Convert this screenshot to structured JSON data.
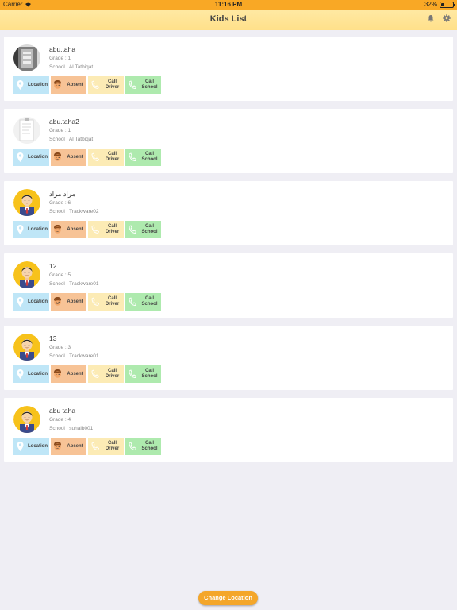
{
  "status_bar": {
    "carrier": "Carrier",
    "time": "11:16 PM",
    "battery": "32%",
    "battery_level": 0.32
  },
  "nav": {
    "title": "Kids List",
    "icons": [
      "bell-icon",
      "gear-icon"
    ]
  },
  "actions": {
    "location": "Location",
    "absent": "Absent",
    "call_driver": [
      "Call",
      "Driver"
    ],
    "call_school": [
      "Call",
      "School"
    ]
  },
  "kids": [
    {
      "name": "abu.taha",
      "grade": "Grade : 1",
      "school": "School : Al Tatbiqat",
      "avatar": "photo-dark"
    },
    {
      "name": "abu.taha2",
      "grade": "Grade : 1",
      "school": "School : Al Tatbiqat",
      "avatar": "photo-light"
    },
    {
      "name": "مراد مراد",
      "grade": "Grade : 6",
      "school": "School : Trackware02",
      "avatar": "cartoon-boy"
    },
    {
      "name": "12",
      "grade": "Grade : 5",
      "school": "School : Trackware01",
      "avatar": "cartoon-boy"
    },
    {
      "name": "13",
      "grade": "Grade : 3",
      "school": "School : Trackware01",
      "avatar": "cartoon-boy"
    },
    {
      "name": "abu taha",
      "grade": "Grade : 4",
      "school": "School : suhaib001",
      "avatar": "cartoon-boy"
    }
  ],
  "footer": {
    "change_location": "Change Location"
  },
  "colors": {
    "status_bar": "#f9a825",
    "nav_bar": "#ffe08a",
    "location": "#bfe6f7",
    "absent": "#f7c396",
    "call_driver": "#fcebb5",
    "call_school": "#aeeaae",
    "button": "#f4a62a"
  }
}
